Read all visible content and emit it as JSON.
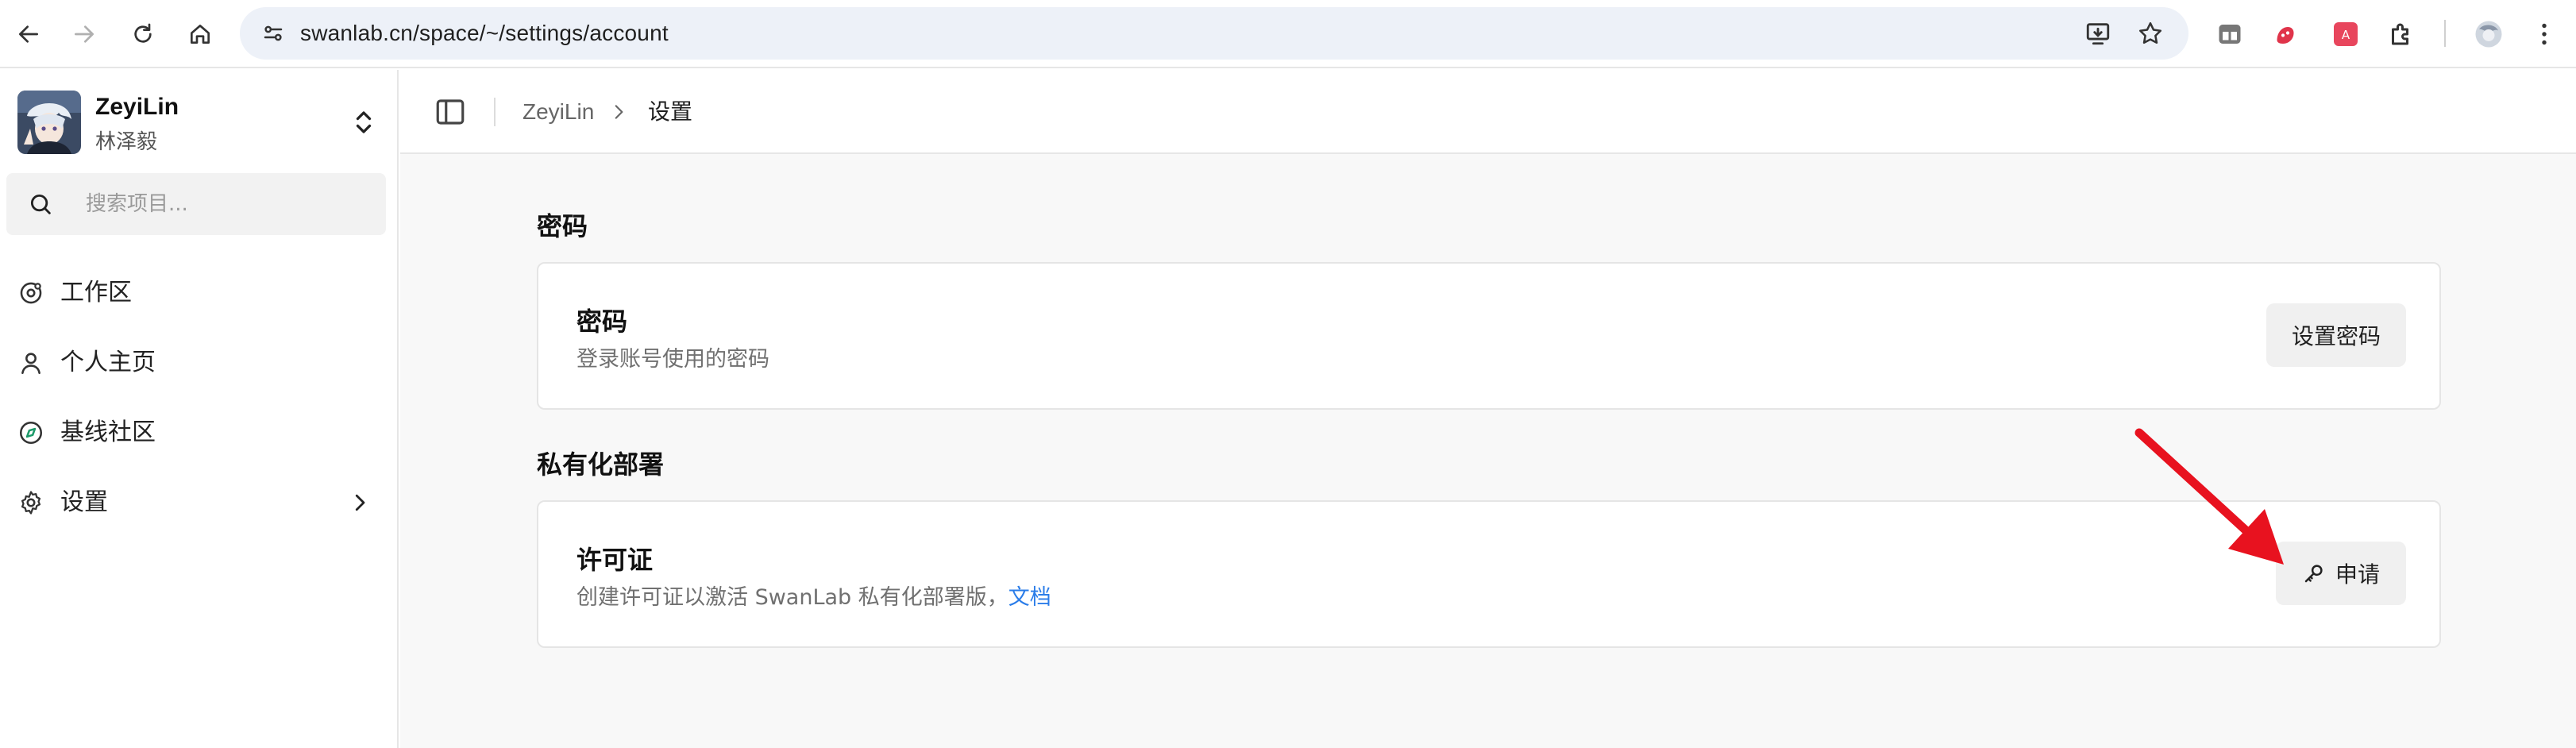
{
  "browser": {
    "url": "swanlab.cn/space/~/settings/account",
    "icons": [
      "back-icon",
      "forward-icon",
      "reload-icon",
      "home-icon",
      "site-info-icon",
      "install-app-icon",
      "bookmark-star-icon",
      "tab-search-icon",
      "extension-red-icon",
      "extension-pink-icon",
      "extensions-puzzle-icon",
      "profile-avatar-icon",
      "more-menu-icon"
    ]
  },
  "sidebar": {
    "user": {
      "name": "ZeyiLin",
      "subtitle": "林泽毅"
    },
    "search": {
      "placeholder": "搜索项目..."
    },
    "items": [
      {
        "label": "工作区",
        "icon": "workspace-icon"
      },
      {
        "label": "个人主页",
        "icon": "user-icon"
      },
      {
        "label": "基线社区",
        "icon": "compass-icon"
      },
      {
        "label": "设置",
        "icon": "gear-icon",
        "has_chevron": true
      }
    ]
  },
  "header": {
    "breadcrumb": [
      "ZeyiLin",
      "设置"
    ]
  },
  "sections": [
    {
      "title": "密码",
      "card": {
        "title": "密码",
        "desc": "登录账号使用的密码",
        "button": "设置密码"
      }
    },
    {
      "title": "私有化部署",
      "card": {
        "title": "许可证",
        "desc": "创建许可证以激活 SwanLab 私有化部署版，",
        "link": "文档",
        "button": "申请",
        "button_icon": "key-icon"
      }
    }
  ],
  "colors": {
    "link": "#2b7de9",
    "arrow": "#e8121f",
    "omnibox": "#edf1f8"
  }
}
